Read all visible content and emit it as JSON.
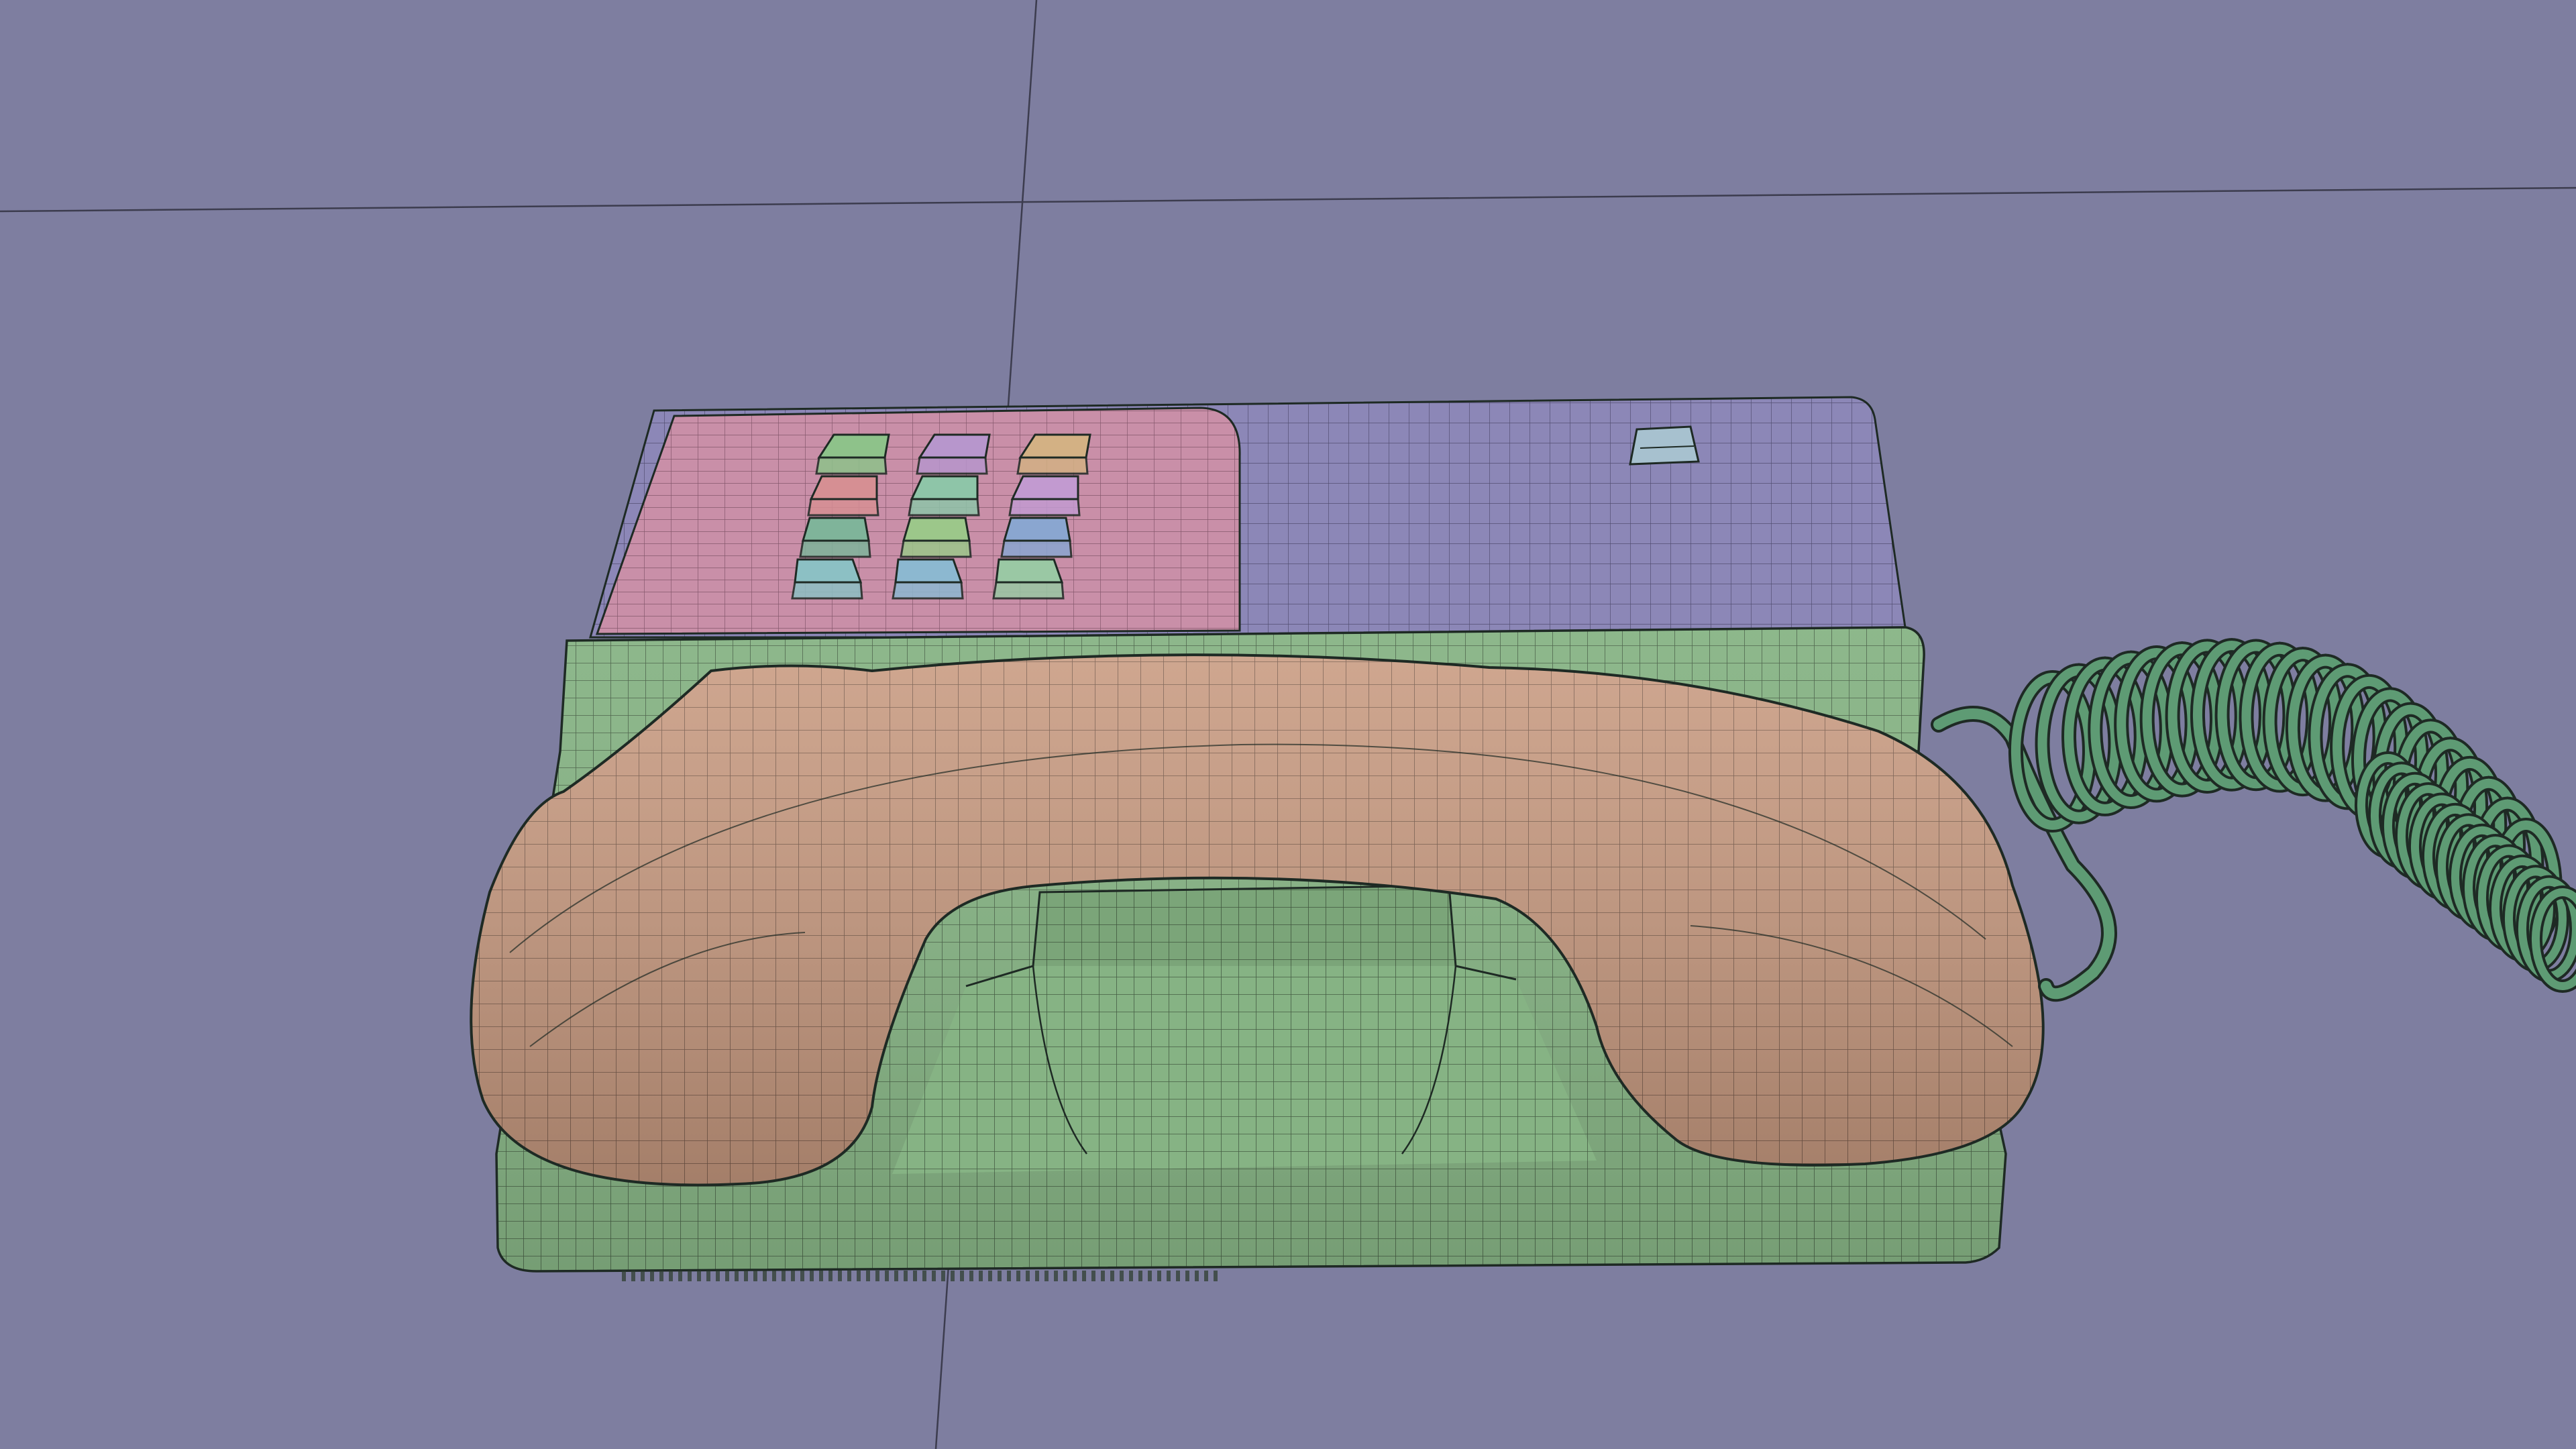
{
  "viewport": {
    "background": "#7e7ea0",
    "grid_axis_color": "#3c3c4e"
  },
  "model": {
    "object": "desk-telephone",
    "wire_color": "#1e2a24",
    "parts": {
      "base": {
        "color": "#86b384"
      },
      "handset": {
        "color": "#c89a80"
      },
      "keypad_well": {
        "color": "#c98fa8"
      },
      "top_panel": {
        "color": "#8c87b7"
      },
      "cord": {
        "color": "#5e9b74"
      },
      "small_button": {
        "color": "#a7c1cf"
      }
    },
    "keys": [
      {
        "color": "#8ec28a"
      },
      {
        "color": "#b796cc"
      },
      {
        "color": "#d3b184"
      },
      {
        "color": "#d68f93"
      },
      {
        "color": "#8ec5a8"
      },
      {
        "color": "#c29ad0"
      },
      {
        "color": "#7fb49a"
      },
      {
        "color": "#9cc78a"
      },
      {
        "color": "#8aa6d0"
      },
      {
        "color": "#8cc0c4"
      },
      {
        "color": "#8cb8d0"
      },
      {
        "color": "#9ac8a4"
      }
    ]
  }
}
